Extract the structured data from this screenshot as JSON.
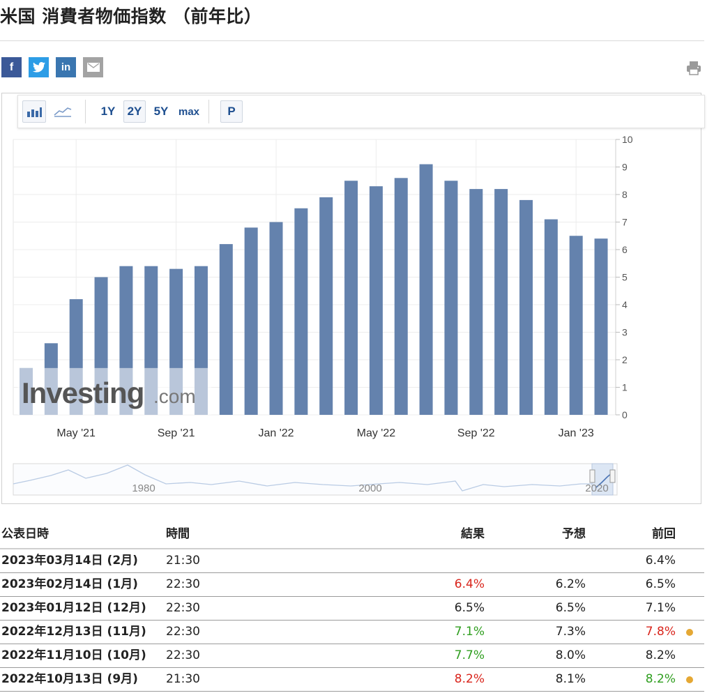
{
  "page": {
    "title": "米国 消費者物価指数 （前年比）"
  },
  "share": {
    "facebook_icon": "f",
    "twitter_icon": "twitter-bird",
    "linkedin_icon": "in",
    "email_icon": "envelope",
    "colors": {
      "facebook": "#3b5998",
      "twitter": "#2d9de6",
      "linkedin": "#3a76b0",
      "email": "#a3a3a3"
    }
  },
  "toolbar": {
    "ranges": [
      "1Y",
      "2Y",
      "5Y",
      "max"
    ],
    "selected_range": "2Y",
    "p_label": "P"
  },
  "chart_data": {
    "type": "bar",
    "categories": [
      "Mar '21",
      "Apr '21",
      "May '21",
      "Jun '21",
      "Jul '21",
      "Aug '21",
      "Sep '21",
      "Oct '21",
      "Nov '21",
      "Dec '21",
      "Jan '22",
      "Feb '22",
      "Mar '22",
      "Apr '22",
      "May '22",
      "Jun '22",
      "Jul '22",
      "Aug '22",
      "Sep '22",
      "Oct '22",
      "Nov '22",
      "Dec '22",
      "Jan '23",
      "Feb '23"
    ],
    "values": [
      1.7,
      2.6,
      4.2,
      5.0,
      5.4,
      5.4,
      5.3,
      5.4,
      6.2,
      6.8,
      7.0,
      7.5,
      7.9,
      8.5,
      8.3,
      8.6,
      9.1,
      8.5,
      8.2,
      8.2,
      7.8,
      7.1,
      6.5,
      6.4
    ],
    "x_tick_labels": [
      "May '21",
      "Sep '21",
      "Jan '22",
      "May '22",
      "Sep '22",
      "Jan '23"
    ],
    "y_tick_labels": [
      "0",
      "1",
      "2",
      "3",
      "4",
      "5",
      "6",
      "7",
      "8",
      "9",
      "10"
    ],
    "ylim": [
      0,
      10
    ],
    "grid": true,
    "bar_color": "#6482ad",
    "watermark": "Investing.com",
    "navigator_labels": [
      "1980",
      "2000",
      "2020"
    ]
  },
  "table": {
    "headers": {
      "date": "公表日時",
      "time": "時間",
      "result": "結果",
      "forecast": "予想",
      "previous": "前回"
    },
    "rows": [
      {
        "date": "2023年03月14日 (2月)",
        "time": "21:30",
        "result": "",
        "forecast": "",
        "previous": "6.4%",
        "result_color": "",
        "prev_color": "",
        "dot": false
      },
      {
        "date": "2023年02月14日 (1月)",
        "time": "22:30",
        "result": "6.4%",
        "forecast": "6.2%",
        "previous": "6.5%",
        "result_color": "red",
        "prev_color": "",
        "dot": false
      },
      {
        "date": "2023年01月12日 (12月)",
        "time": "22:30",
        "result": "6.5%",
        "forecast": "6.5%",
        "previous": "7.1%",
        "result_color": "",
        "prev_color": "",
        "dot": false
      },
      {
        "date": "2022年12月13日 (11月)",
        "time": "22:30",
        "result": "7.1%",
        "forecast": "7.3%",
        "previous": "7.8%",
        "result_color": "green",
        "prev_color": "red",
        "dot": true
      },
      {
        "date": "2022年11月10日 (10月)",
        "time": "22:30",
        "result": "7.7%",
        "forecast": "8.0%",
        "previous": "8.2%",
        "result_color": "green",
        "prev_color": "",
        "dot": false
      },
      {
        "date": "2022年10月13日 (9月)",
        "time": "21:30",
        "result": "8.2%",
        "forecast": "8.1%",
        "previous": "8.2%",
        "result_color": "red",
        "prev_color": "green",
        "dot": true
      }
    ]
  }
}
